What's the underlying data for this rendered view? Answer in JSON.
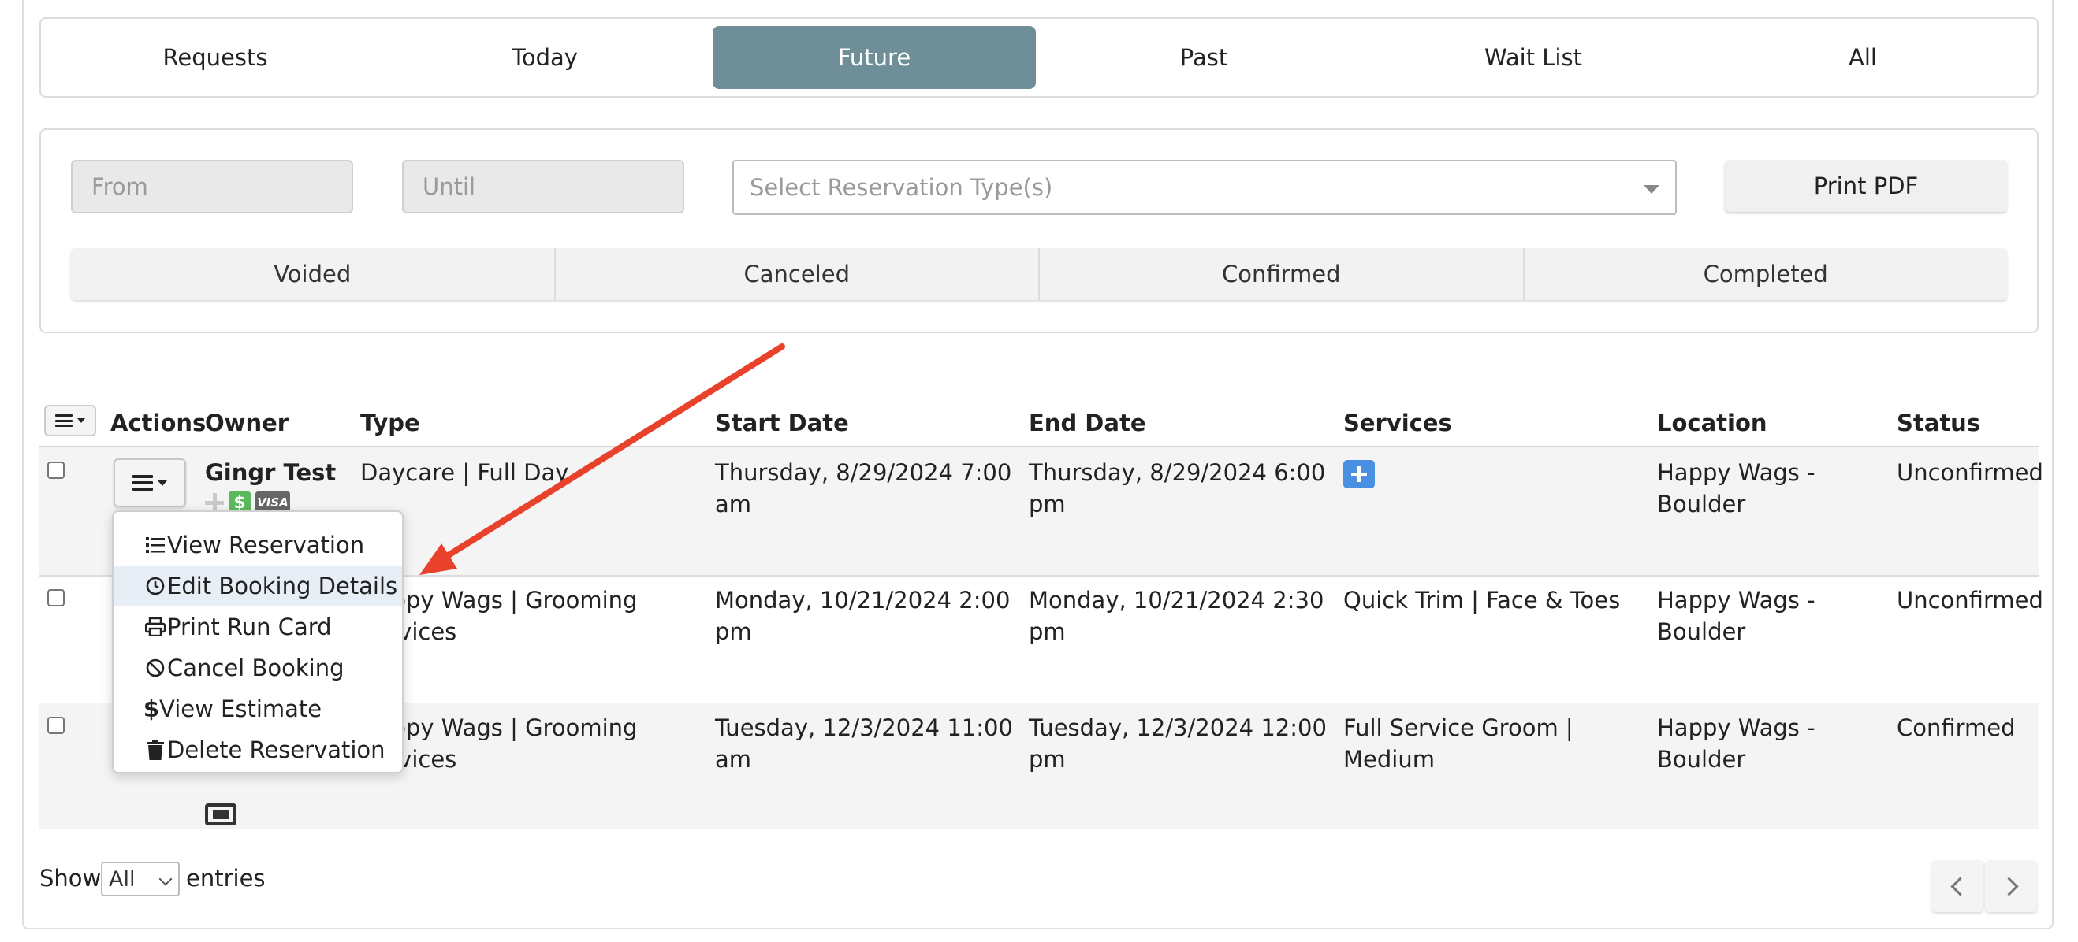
{
  "tabs": [
    {
      "label": "Requests",
      "active": false
    },
    {
      "label": "Today",
      "active": false
    },
    {
      "label": "Future",
      "active": true
    },
    {
      "label": "Past",
      "active": false
    },
    {
      "label": "Wait List",
      "active": false
    },
    {
      "label": "All",
      "active": false
    }
  ],
  "filters": {
    "from_placeholder": "From",
    "until_placeholder": "Until",
    "type_placeholder": "Select Reservation Type(s)",
    "print_label": "Print PDF",
    "statuses": [
      "Voided",
      "Canceled",
      "Confirmed",
      "Completed"
    ]
  },
  "table": {
    "headers": {
      "actions": "Actions",
      "owner": "Owner",
      "type": "Type",
      "start": "Start Date",
      "end": "End Date",
      "services": "Services",
      "location": "Location",
      "status": "Status"
    },
    "rows": [
      {
        "owner": "Gingr Test",
        "type": "Daycare | Full Day",
        "start": "Thursday, 8/29/2024 7:00 am",
        "end": "Thursday, 8/29/2024 6:00 pm",
        "services": "",
        "location": "Happy Wags - Boulder",
        "status": "Unconfirmed"
      },
      {
        "owner": "",
        "type": "Happy Wags | Grooming Services",
        "start": "Monday, 10/21/2024 2:00 pm",
        "end": "Monday, 10/21/2024 2:30 pm",
        "services": "Quick Trim | Face & Toes",
        "location": "Happy Wags - Boulder",
        "status": "Unconfirmed"
      },
      {
        "owner": "",
        "type": "Happy Wags | Grooming Services",
        "start": "Tuesday, 12/3/2024 11:00 am",
        "end": "Tuesday, 12/3/2024 12:00 pm",
        "services": "Full Service Groom | Medium",
        "location": "Happy Wags - Boulder",
        "status": "Confirmed"
      }
    ]
  },
  "action_menu": {
    "items": [
      {
        "label": "View Reservation",
        "icon": "list-icon"
      },
      {
        "label": "Edit Booking Details",
        "icon": "clock-icon"
      },
      {
        "label": "Print Run Card",
        "icon": "printer-icon"
      },
      {
        "label": "Cancel Booking",
        "icon": "ban-icon"
      },
      {
        "label": "View Estimate",
        "icon": "dollar-icon"
      },
      {
        "label": "Delete Reservation",
        "icon": "trash-icon"
      }
    ],
    "highlighted_index": 1
  },
  "footer": {
    "show_label": "Show",
    "entries_value": "All",
    "entries_label": "entries"
  },
  "colors": {
    "active_tab": "#6f8f98",
    "annotation_arrow": "#e8412c",
    "service_add": "#4a90e2",
    "payment_dollar": "#5cb85c"
  }
}
